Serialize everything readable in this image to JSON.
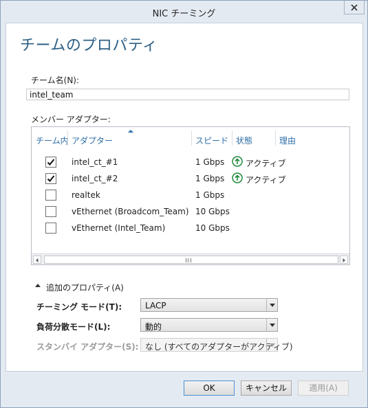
{
  "window": {
    "title": "NIC チーミング"
  },
  "page": {
    "heading": "チームのプロパティ"
  },
  "team_name": {
    "label": "チーム名(N):",
    "value": "intel_team"
  },
  "member_adapters": {
    "label": "メンバー アダプター:",
    "columns": [
      "チーム内",
      "アダプター",
      "スピード",
      "状態",
      "理由"
    ],
    "rows": [
      {
        "in_team": true,
        "adapter": "intel_ct_#1",
        "speed": "1 Gbps",
        "status": "アクティブ",
        "reason": ""
      },
      {
        "in_team": true,
        "adapter": "intel_ct_#2",
        "speed": "1 Gbps",
        "status": "アクティブ",
        "reason": ""
      },
      {
        "in_team": false,
        "adapter": "realtek",
        "speed": "1 Gbps",
        "status": "",
        "reason": ""
      },
      {
        "in_team": false,
        "adapter": "vEthernet (Broadcom_Team)",
        "speed": "10 Gbps",
        "status": "",
        "reason": ""
      },
      {
        "in_team": false,
        "adapter": "vEthernet (Intel_Team)",
        "speed": "10 Gbps",
        "status": "",
        "reason": ""
      }
    ]
  },
  "additional_properties": {
    "toggle_label": "追加のプロパティ(A)",
    "teaming_mode": {
      "label": "チーミング モード(T):",
      "value": "LACP"
    },
    "load_balancing": {
      "label": "負荷分散モード(L):",
      "value": "動的"
    },
    "standby_adapter": {
      "label": "スタンバイ アダプター(S):",
      "value": "なし (すべてのアダプターがアクティブ)"
    }
  },
  "buttons": {
    "ok": "OK",
    "cancel": "キャンセル",
    "apply": "適用(A)"
  },
  "colors": {
    "heading": "#2b5f84",
    "column_header": "#2e6fa8",
    "status_active": "#1f8a3a",
    "window_bg": "#e4eaf2"
  },
  "icons": {
    "close": "close-icon",
    "status_active": "up-arrow-circle-icon",
    "check": "checkmark-icon"
  }
}
